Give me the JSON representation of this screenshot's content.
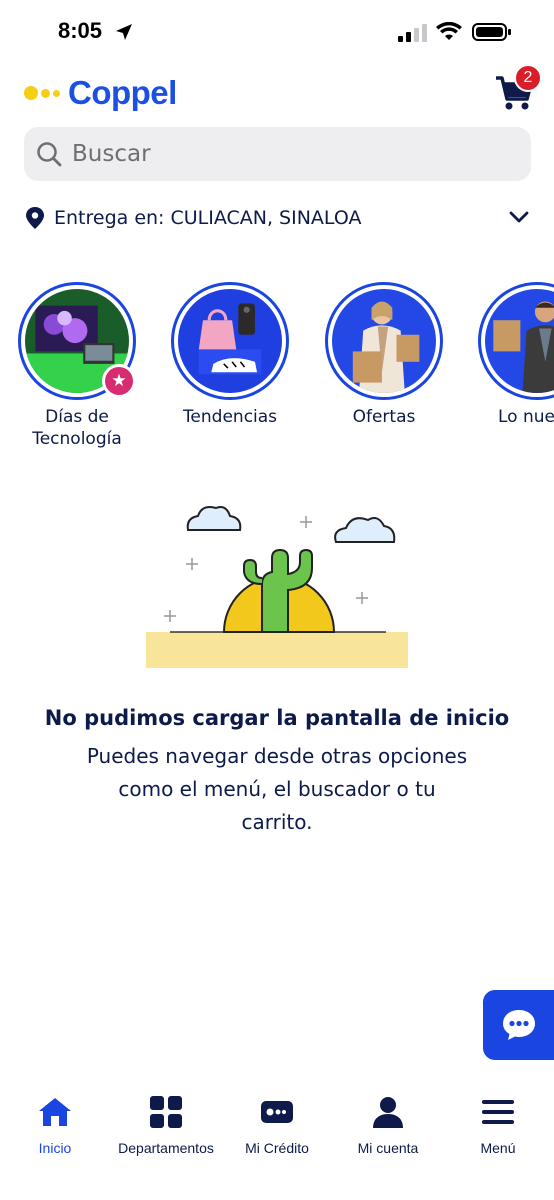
{
  "status_bar": {
    "time": "8:05"
  },
  "header": {
    "logo_text": "Coppel",
    "cart_count": "2"
  },
  "search": {
    "placeholder": "Buscar"
  },
  "delivery": {
    "prefix": "Entrega en:",
    "city": "CULIACAN, SINALOA"
  },
  "categories": [
    {
      "label_line1": "Días de",
      "label_line2": "Tecnología",
      "icon": "tv-image"
    },
    {
      "label_line1": "Tendencias",
      "label_line2": "",
      "icon": "bag-image"
    },
    {
      "label_line1": "Ofertas",
      "label_line2": "",
      "icon": "shopper-image"
    },
    {
      "label_line1": "Lo nue",
      "label_line2": "",
      "icon": "new-image"
    }
  ],
  "message": {
    "title": "No pudimos cargar la pantalla de inicio",
    "body": "Puedes navegar desde otras opciones como el menú, el buscador o tu carrito."
  },
  "bottom_nav": [
    {
      "label": "Inicio",
      "icon": "home-icon",
      "active": true
    },
    {
      "label": "Departamentos",
      "icon": "grid-icon",
      "active": false
    },
    {
      "label": "Mi Crédito",
      "icon": "credit-card-icon",
      "active": false
    },
    {
      "label": "Mi cuenta",
      "icon": "user-icon",
      "active": false
    },
    {
      "label": "Menú",
      "icon": "hamburger-icon",
      "active": false
    }
  ],
  "colors": {
    "brand_blue": "#1b45e0",
    "logo_yellow": "#f4cf16",
    "badge_red": "#d91e2a",
    "text_navy": "#0d1a4a"
  }
}
